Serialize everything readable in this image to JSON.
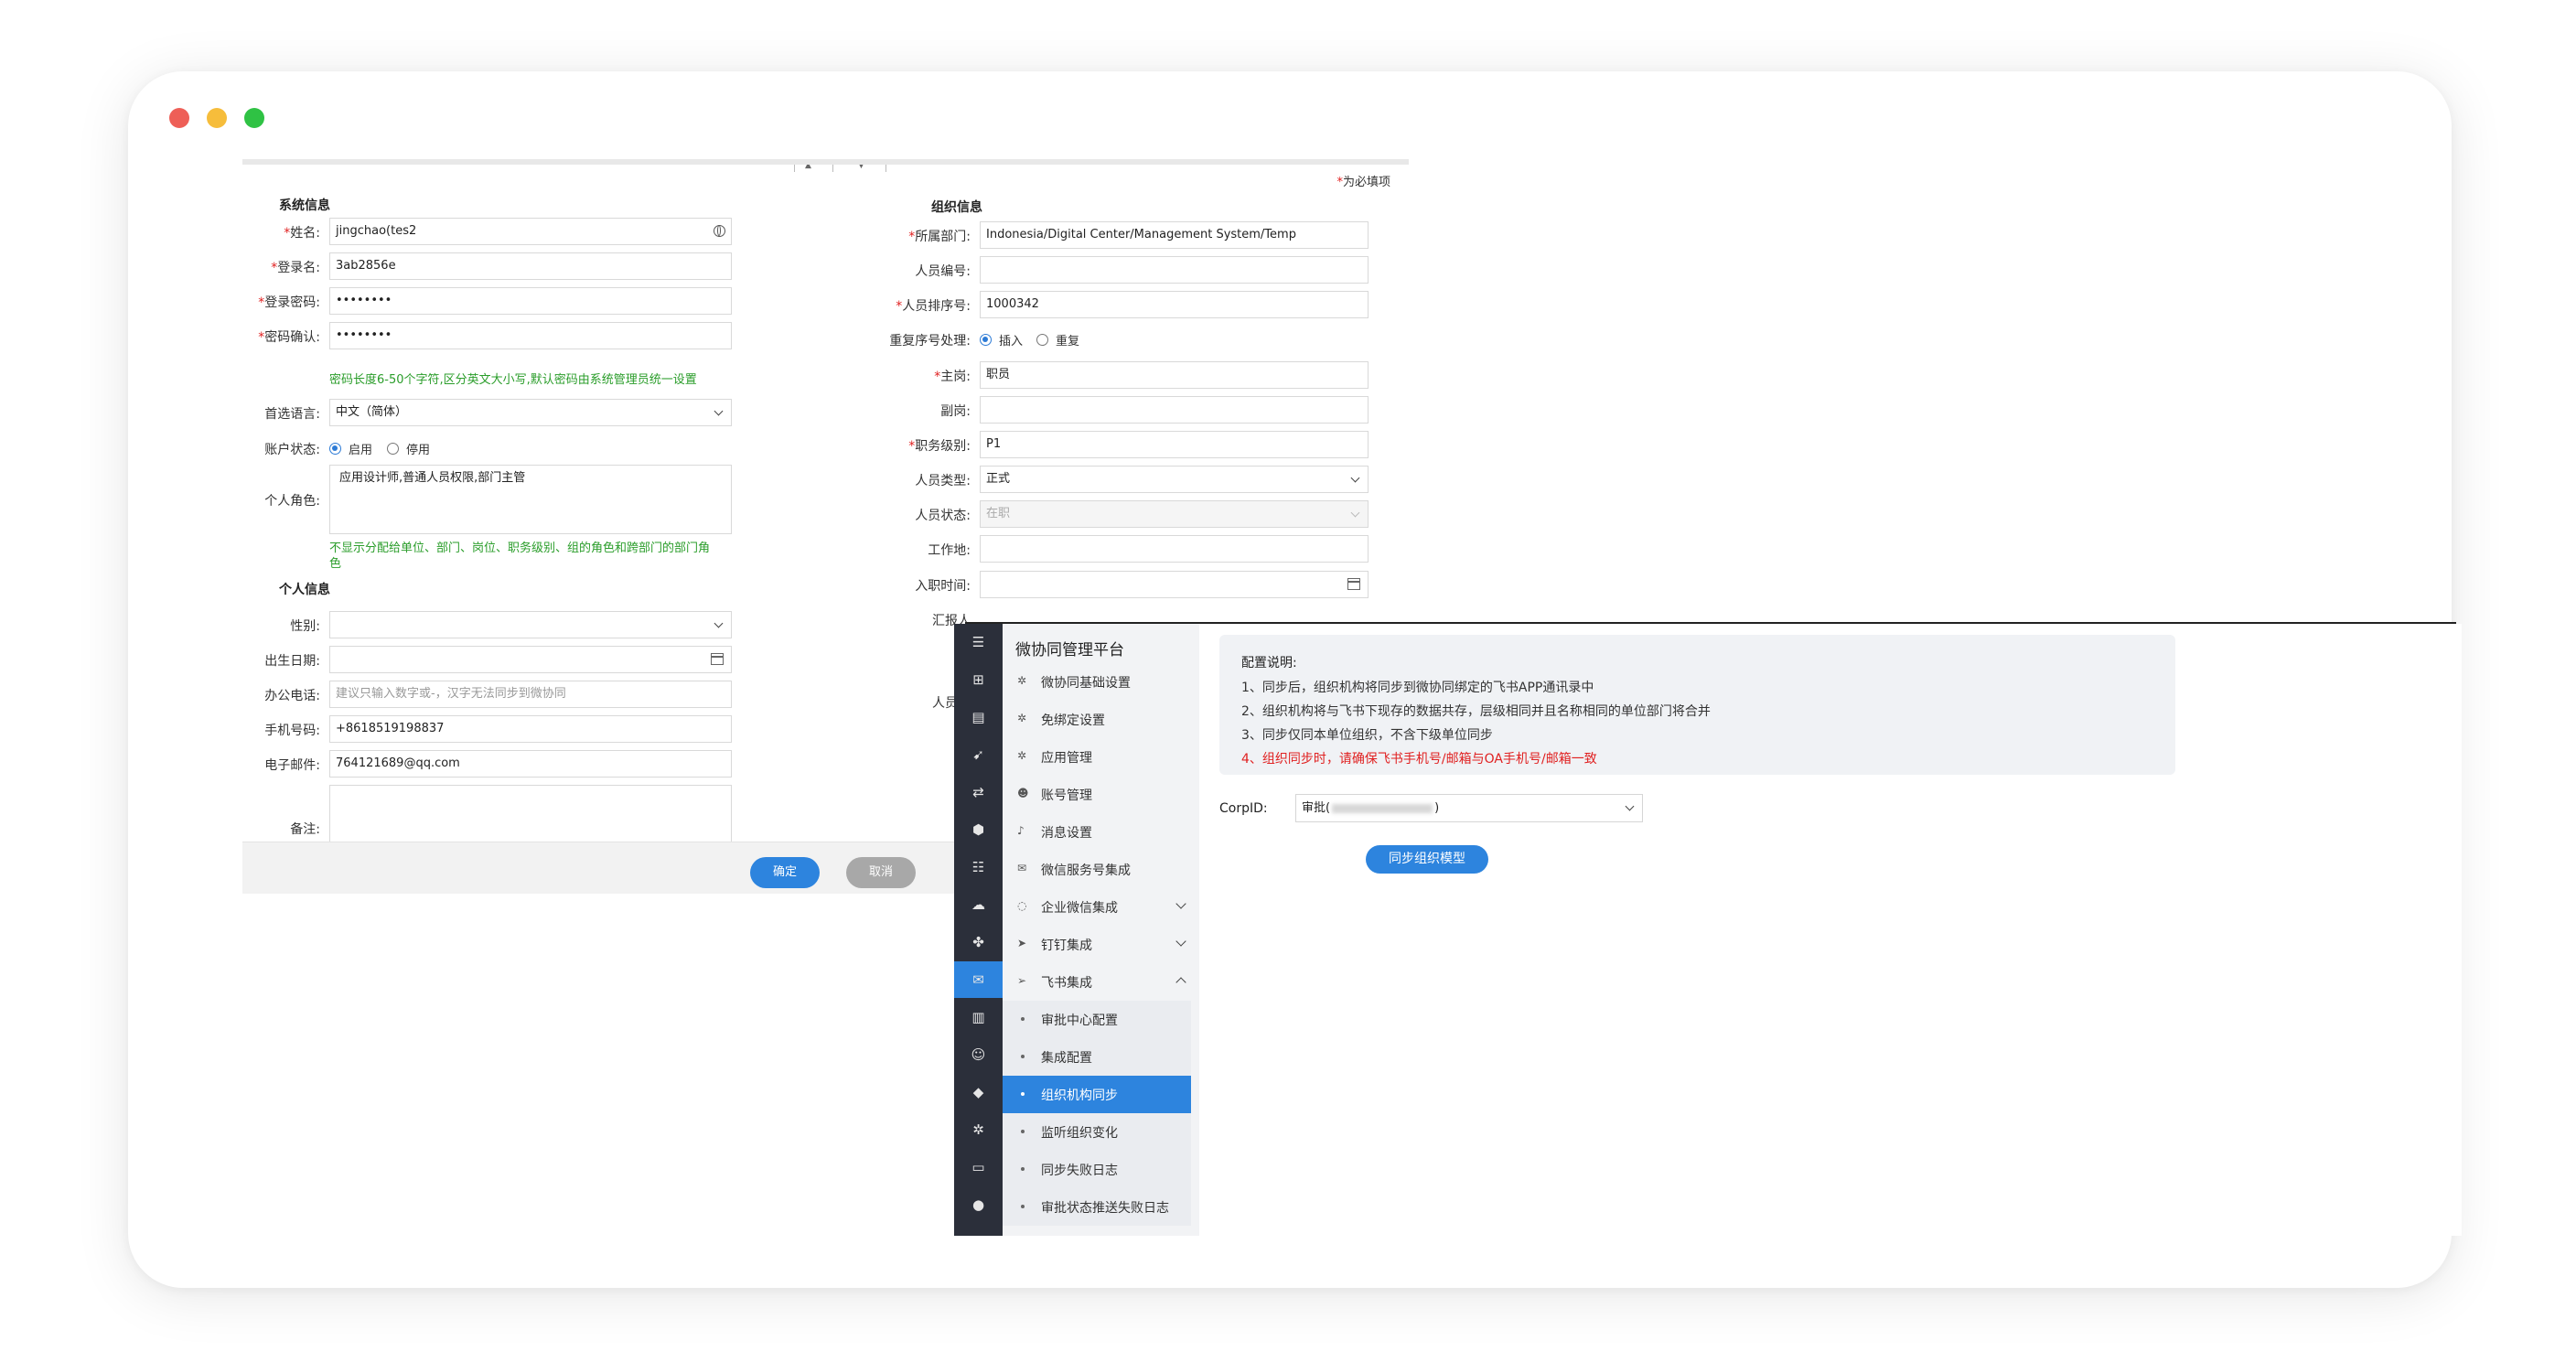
{
  "window": {
    "controls": [
      "close",
      "minimize",
      "maximize"
    ]
  },
  "form": {
    "required_note": "为必填项",
    "system_info": {
      "title": "系统信息",
      "name_label": "姓名:",
      "name_value": "jingchao(tes2",
      "login_label": "登录名:",
      "login_value": "3ab2856e",
      "password_label": "登录密码:",
      "password_value": "••••••••",
      "confirm_label": "密码确认:",
      "confirm_value": "••••••••",
      "password_hint": "密码长度6-50个字符,区分英文大小写,默认密码由系统管理员统一设置",
      "language_label": "首选语言:",
      "language_value": "中文（简体）",
      "status_label": "账户状态:",
      "status_enabled": "启用",
      "status_disabled": "停用",
      "role_label": "个人角色:",
      "role_value": "应用设计师,普通人员权限,部门主管",
      "role_hint_1": "不显示分配给单位、部门、岗位、职务级别、组的角色和跨部门的部门角",
      "role_hint_2": "色"
    },
    "personal_info": {
      "title": "个人信息",
      "gender_label": "性别:",
      "gender_value": "",
      "birthday_label": "出生日期:",
      "birthday_value": "",
      "office_phone_label": "办公电话:",
      "office_phone_placeholder": "建议只输入数字或-，汉字无法同步到微协同",
      "mobile_label": "手机号码:",
      "mobile_value": "+8618519198837",
      "email_label": "电子邮件:",
      "email_value": "764121689@qq.com",
      "remark_label": "备注:",
      "remark_value": ""
    },
    "org_info": {
      "title": "组织信息",
      "dept_label": "所属部门:",
      "dept_value": "Indonesia/Digital Center/Management System/Temp",
      "number_label": "人员编号:",
      "number_value": "",
      "sort_label": "人员排序号:",
      "sort_value": "1000342",
      "dup_label": "重复序号处理:",
      "dup_insert": "插入",
      "dup_repeat": "重复",
      "main_post_label": "主岗:",
      "main_post_value": "职员",
      "sub_post_label": "副岗:",
      "sub_post_value": "",
      "level_label": "职务级别:",
      "level_value": "P1",
      "type_label": "人员类型:",
      "type_value": "正式",
      "state_label": "人员状态:",
      "state_value": "在职",
      "workplace_label": "工作地:",
      "workplace_value": "",
      "hire_label": "入职时间:",
      "hire_value": "",
      "report_label": "汇报人",
      "person_label": "人员同"
    },
    "buttons": {
      "ok": "确定",
      "cancel": "取消"
    }
  },
  "platform": {
    "title": "微协同管理平台",
    "menu": [
      {
        "label": "微协同基础设置",
        "icon": "gear-icon"
      },
      {
        "label": "免绑定设置",
        "icon": "gear-icon"
      },
      {
        "label": "应用管理",
        "icon": "gear-icon"
      },
      {
        "label": "账号管理",
        "icon": "users-icon"
      },
      {
        "label": "消息设置",
        "icon": "bell-icon"
      },
      {
        "label": "微信服务号集成",
        "icon": "wechat-icon"
      },
      {
        "label": "企业微信集成",
        "icon": "chat-icon"
      },
      {
        "label": "钉钉集成",
        "icon": "dingtalk-icon"
      },
      {
        "label": "飞书集成",
        "icon": "send-icon"
      }
    ],
    "submenu": [
      {
        "label": "审批中心配置"
      },
      {
        "label": "集成配置"
      },
      {
        "label": "组织机构同步"
      },
      {
        "label": "监听组织变化"
      },
      {
        "label": "同步失败日志"
      },
      {
        "label": "审批状态推送失败日志"
      }
    ],
    "config": {
      "title": "配置说明:",
      "lines": [
        "1、同步后，组织机构将同步到微协同绑定的飞书APP通讯录中",
        "2、组织机构将与飞书下现存的数据共存，层级相同并且名称相同的单位部门将合并",
        "3、同步仅同本单位组织，不含下级单位同步",
        "4、组织同步时，请确保飞书手机号/邮箱与OA手机号/邮箱一致"
      ],
      "corp_label": "CorpID:",
      "corp_prefix": "审批(",
      "corp_suffix": ")",
      "sync_button": "同步组织模型"
    },
    "colors": {
      "accent": "#2d84de",
      "sidebar": "#2b2f3a",
      "warning": "#e02020",
      "hint": "#2a9d2a"
    }
  }
}
